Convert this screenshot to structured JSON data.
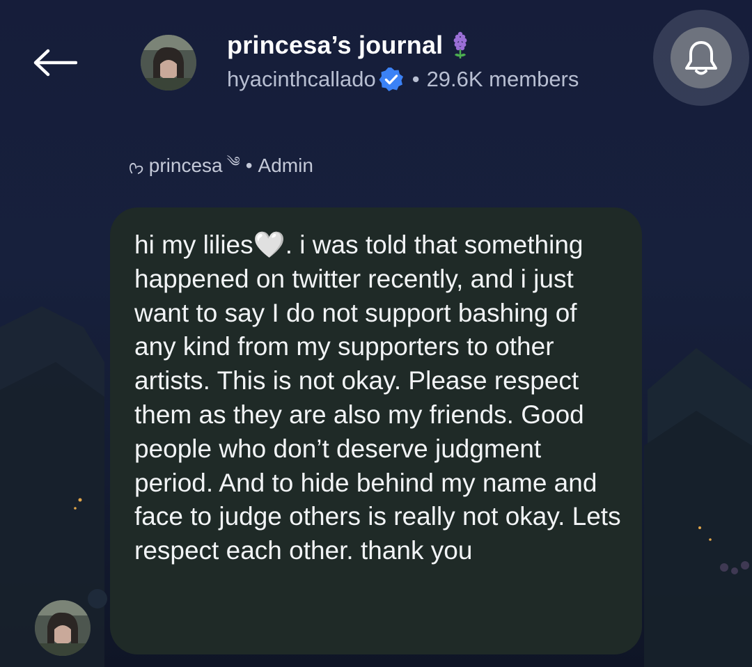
{
  "header": {
    "back_icon": "arrow-left-icon",
    "channel_title": "princesa’s journal",
    "title_emoji_icon": "hyacinth-flower-icon",
    "owner_handle": "hyacinthcallado",
    "verified_icon": "verified-badge-icon",
    "separator": "•",
    "member_count": "29.6K members",
    "bell_icon": "bell-icon"
  },
  "author": {
    "prefix": "ᢉ𐭩",
    "name": "princesa",
    "suffix": "༄",
    "separator": "•",
    "role": "Admin"
  },
  "message": {
    "text": "hi my lilies🤍. i was told that something happened on twitter recently, and i just want to say I do not support bashing of any kind from my supporters to other artists. This is not okay. Please respect them as they are also my friends. Good people who don’t deserve judgment period. And to hide behind my name and face to judge others is really not okay. Lets respect each other. thank you"
  },
  "colors": {
    "background": "#161d3a",
    "bubble": "#1f2a27",
    "verified": "#3b82f6",
    "flower": "#9b6fd6"
  }
}
